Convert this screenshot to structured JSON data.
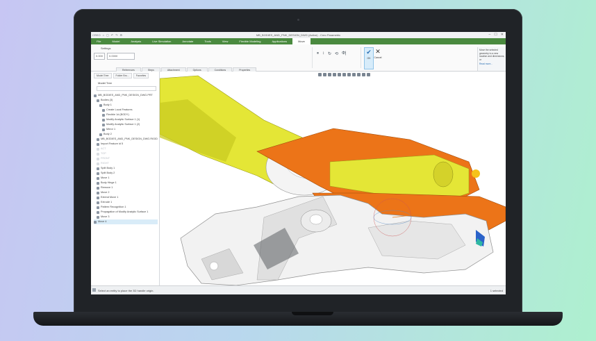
{
  "window": {
    "title": "MB_BODIES_AND_PNK_DESIGN_DWG (Active) - Creo Parametric",
    "quick_access": [
      "CREO",
      "⌂",
      "▢",
      "↶",
      "↷",
      "⚙"
    ],
    "controls": [
      "–",
      "☐",
      "✕"
    ]
  },
  "ribbon": {
    "tabs": [
      "File",
      "Model",
      "Analysis",
      "Live Simulation",
      "Annotate",
      "Tools",
      "View",
      "Flexible Modeling",
      "Applications",
      "Move"
    ],
    "active_tab": "Move",
    "settings_label": "Settings",
    "selector_value": "0.000",
    "unit_value": "0.0000",
    "property_tabs": [
      "References",
      "Steps",
      "Attachment",
      "Options",
      "Conditions",
      "Properties"
    ],
    "handle_icons": [
      "⏸",
      "↕",
      "↻",
      "⟲",
      "Φ|"
    ],
    "ok_label": "OK",
    "cancel_label": "Cancel",
    "help_text": "Move the selected geometry to a new location and dimensions, or",
    "help_link": "Read more..."
  },
  "model_tree": {
    "nav_tabs": [
      "Model Tree",
      "Folder Bro...",
      "Favorites"
    ],
    "title": "Model Tree",
    "items": [
      {
        "label": "MB_BODIES_AND_PNK_DESIGN_DWG.PRT",
        "state": "normal"
      },
      {
        "label": "Bodies (3)",
        "state": "normal"
      },
      {
        "label": "Body 1",
        "state": "normal"
      },
      {
        "label": "Create Local Features",
        "state": "normal"
      },
      {
        "label": "Flexible 1d (BODY)",
        "state": "normal"
      },
      {
        "label": "Modify Analytic Surface 1 (1)",
        "state": "normal"
      },
      {
        "label": "Modify Analytic Surface 1 (2)",
        "state": "normal"
      },
      {
        "label": "Mirror 1",
        "state": "normal"
      },
      {
        "label": "Body 2",
        "state": "normal"
      },
      {
        "label": "MB_BODIES_AND_PNK_DESIGN_DWG.RIGID",
        "state": "normal"
      },
      {
        "label": "Import Feature id 5",
        "state": "normal"
      },
      {
        "label": "ACT",
        "state": "dim"
      },
      {
        "label": "TOP",
        "state": "dim"
      },
      {
        "label": "FRONT",
        "state": "dim"
      },
      {
        "label": "RIGHT",
        "state": "dim"
      },
      {
        "label": "Split Body 1",
        "state": "normal"
      },
      {
        "label": "Split Body 2",
        "state": "normal"
      },
      {
        "label": "Move 1",
        "state": "normal"
      },
      {
        "label": "Body Hinge 1",
        "state": "normal"
      },
      {
        "label": "Remove 1",
        "state": "normal"
      },
      {
        "label": "Move 2",
        "state": "normal"
      },
      {
        "label": "Extend Move 1",
        "state": "normal"
      },
      {
        "label": "Extrude 1",
        "state": "normal"
      },
      {
        "label": "Pattern Recognition 1",
        "state": "normal"
      },
      {
        "label": "Propagation of Modify Analytic Surface 1",
        "state": "normal"
      },
      {
        "label": "Move 3",
        "state": "normal"
      },
      {
        "label": "Move 4",
        "state": "sel"
      }
    ]
  },
  "status": {
    "message": "Select an entity to place the 3D handle origin.",
    "selection": "1 selected"
  },
  "colors": {
    "ribbon_green": "#4a8a3f",
    "part_yellow": "#e4e636",
    "part_orange": "#ec7418",
    "part_grey": "#f0f0f0"
  }
}
